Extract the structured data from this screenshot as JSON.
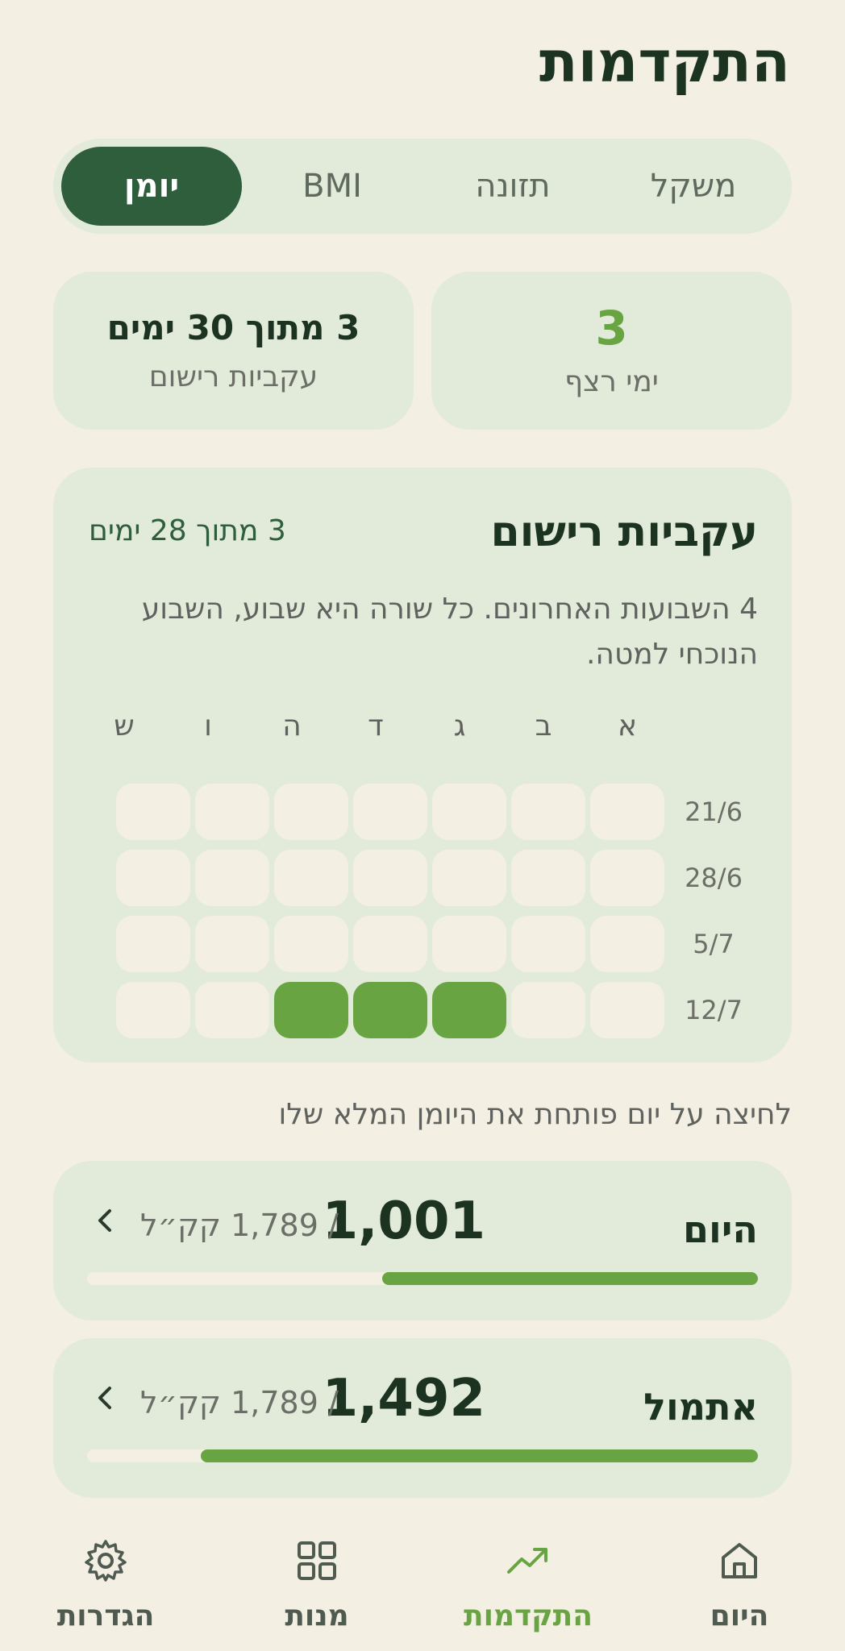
{
  "header": {
    "title": "התקדמות"
  },
  "tabs": [
    {
      "label": "משקל",
      "active": false
    },
    {
      "label": "תזונה",
      "active": false
    },
    {
      "label": "BMI",
      "active": false
    },
    {
      "label": "יומן",
      "active": true
    }
  ],
  "stats": {
    "streak": {
      "value": "3",
      "label": "ימי רצף"
    },
    "consistency": {
      "value": "3 מתוך 30 ימים",
      "label": "עקביות רישום"
    }
  },
  "consistency_card": {
    "title": "עקביות רישום",
    "count": "3 מתוך 28 ימים",
    "description": "4 השבועות האחרונים. כל שורה היא שבוע, השבוע הנוכחי למטה.",
    "days": [
      "א",
      "ב",
      "ג",
      "ד",
      "ה",
      "ו",
      "ש"
    ],
    "weeks": [
      {
        "label": "21/6",
        "logged": [
          false,
          false,
          false,
          false,
          false,
          false,
          false
        ]
      },
      {
        "label": "28/6",
        "logged": [
          false,
          false,
          false,
          false,
          false,
          false,
          false
        ]
      },
      {
        "label": "5/7",
        "logged": [
          false,
          false,
          false,
          false,
          false,
          false,
          false
        ]
      },
      {
        "label": "12/7",
        "logged": [
          false,
          false,
          true,
          true,
          true,
          false,
          false
        ]
      }
    ]
  },
  "hint": "לחיצה על יום פותחת את היומן המלא שלו",
  "day_cards": [
    {
      "label": "היום",
      "value": "1,001",
      "goal": "/ 1,789 קק״ל",
      "progress": 0.56
    },
    {
      "label": "אתמול",
      "value": "1,492",
      "goal": "/ 1,789 קק״ל",
      "progress": 0.83
    }
  ],
  "bottom_nav": [
    {
      "label": "היום",
      "icon": "home-icon",
      "active": false
    },
    {
      "label": "התקדמות",
      "icon": "trending-up-icon",
      "active": true
    },
    {
      "label": "מנות",
      "icon": "grid-icon",
      "active": false
    },
    {
      "label": "הגדרות",
      "icon": "gear-icon",
      "active": false
    }
  ],
  "colors": {
    "background": "#f3efe3",
    "card": "#e2ebd9",
    "accent": "#69a443",
    "dark_green": "#2f5e3d"
  }
}
